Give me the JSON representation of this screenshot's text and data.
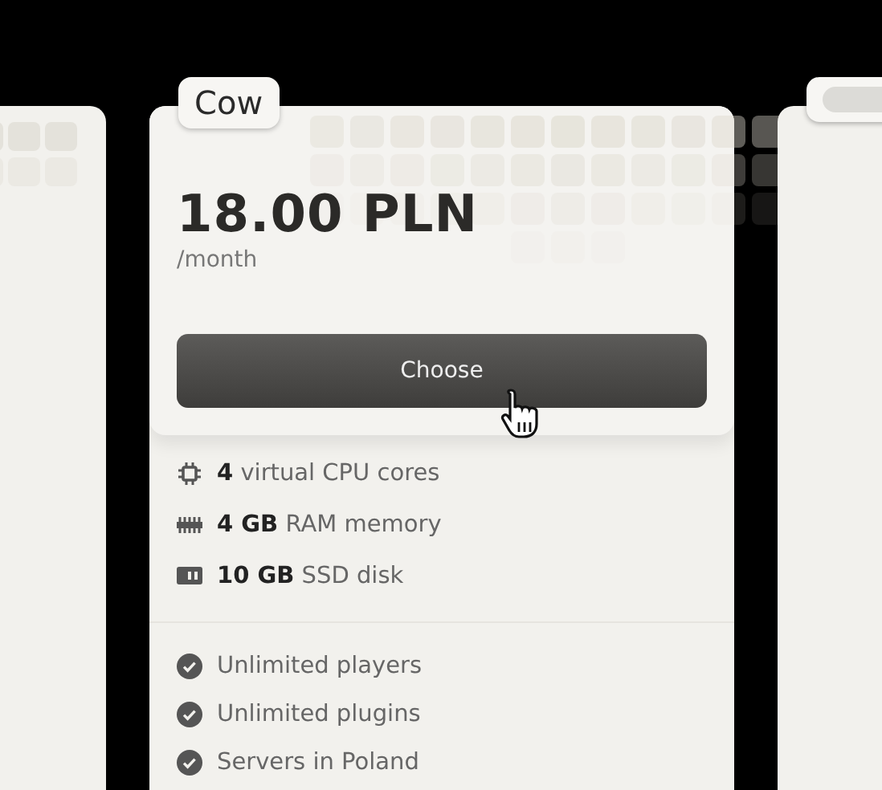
{
  "plan": {
    "name": "Cow",
    "price": "18.00 PLN",
    "period": "/month",
    "button": "Choose",
    "specs": [
      {
        "kind": "cpu",
        "text": "**4** virtual CPU cores"
      },
      {
        "kind": "ram",
        "text": "**4 GB** RAM memory"
      },
      {
        "kind": "disk",
        "text": "**10 GB** SSD disk"
      }
    ],
    "features": [
      "Unlimited players",
      "Unlimited plugins",
      "Servers in Poland"
    ]
  }
}
